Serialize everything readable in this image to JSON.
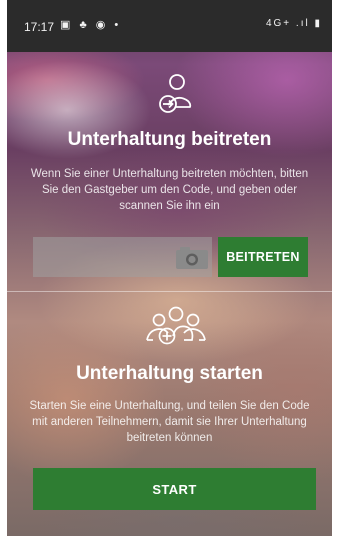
{
  "status_bar": {
    "time": "17:17",
    "left_icons": "▣ ♣ ◉ •",
    "right_icons": "4G+ .ıl ▮"
  },
  "join": {
    "title": "Unterhaltung beitreten",
    "description": "Wenn Sie einer Unterhaltung beitreten möchten, bitten Sie den Gastgeber um den Code, und geben oder scannen Sie ihn ein",
    "code_value": "",
    "button_label": "BEITRETEN"
  },
  "start": {
    "title": "Unterhaltung starten",
    "description": "Starten Sie eine Unterhaltung, und teilen Sie den Code mit anderen Teilnehmern, damit sie Ihrer Unterhaltung beitreten können",
    "button_label": "START"
  },
  "icons": {
    "join_icon": "person-join-icon",
    "camera_icon": "camera-icon",
    "group_icon": "group-add-icon"
  },
  "colors": {
    "accent": "#2e7d32",
    "status_bar": "#2b2b2b"
  }
}
